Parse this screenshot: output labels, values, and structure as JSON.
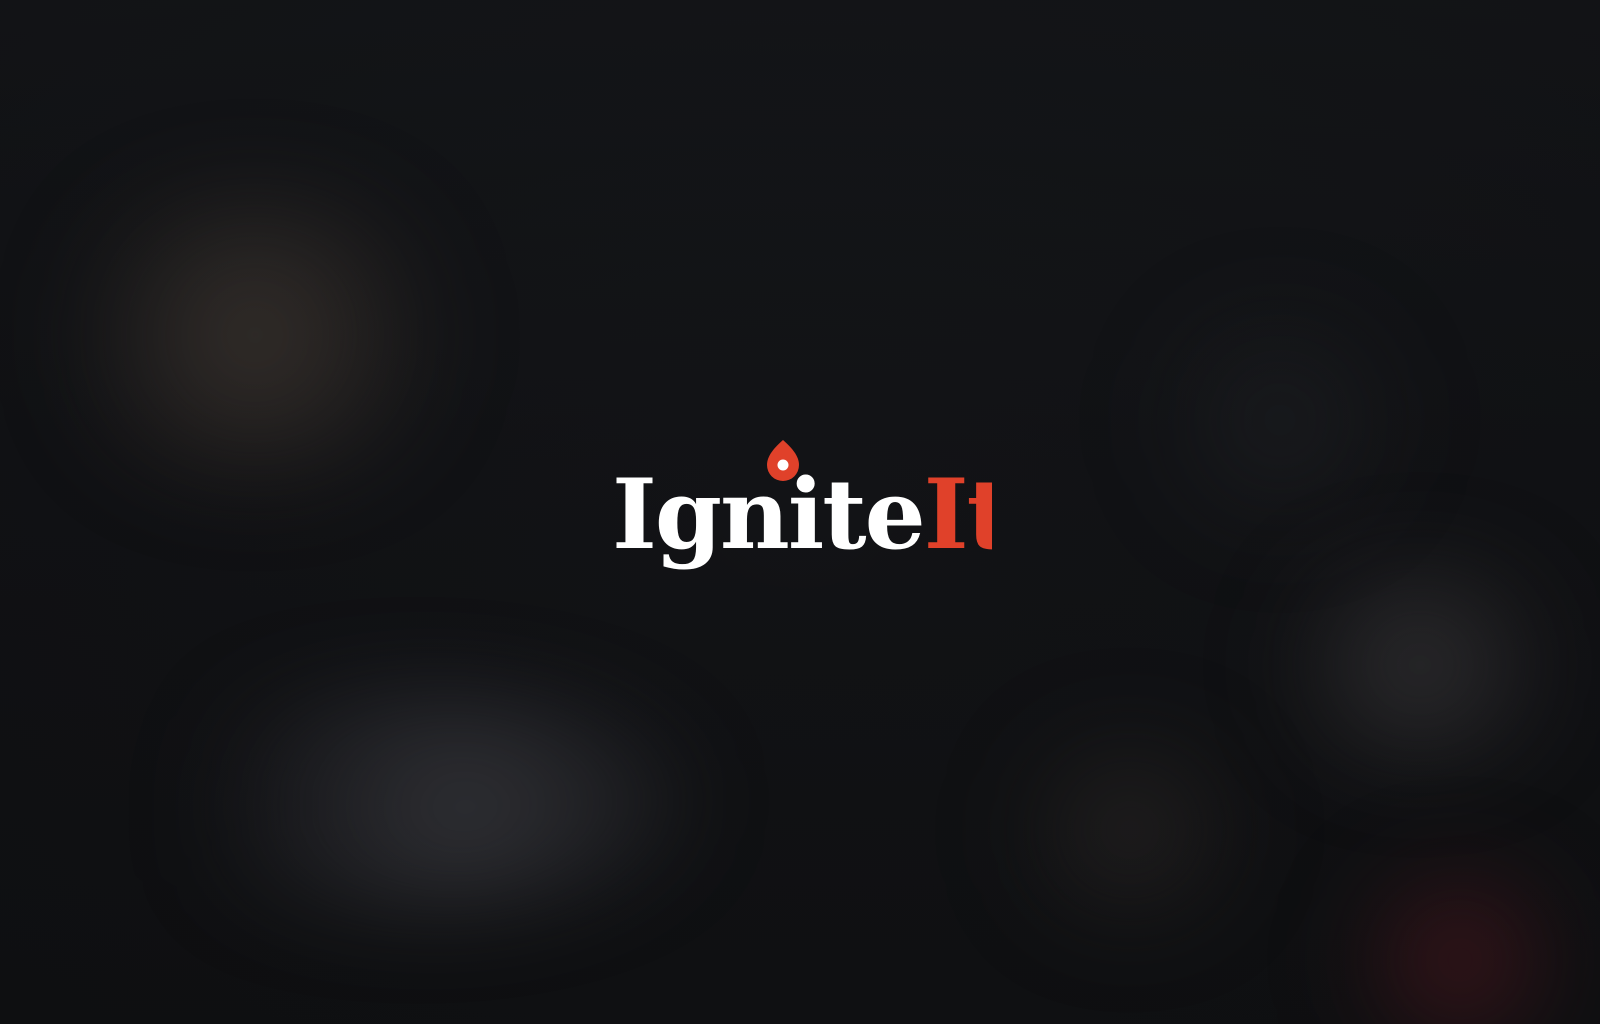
{
  "splash": {
    "logo": {
      "part_primary": "Ignite",
      "part_accent": "It",
      "primary_color": "#ffffff",
      "accent_color": "#e0412a",
      "flame_color": "#e0412a",
      "icon": "flame-icon"
    },
    "background_color": "#121316"
  }
}
